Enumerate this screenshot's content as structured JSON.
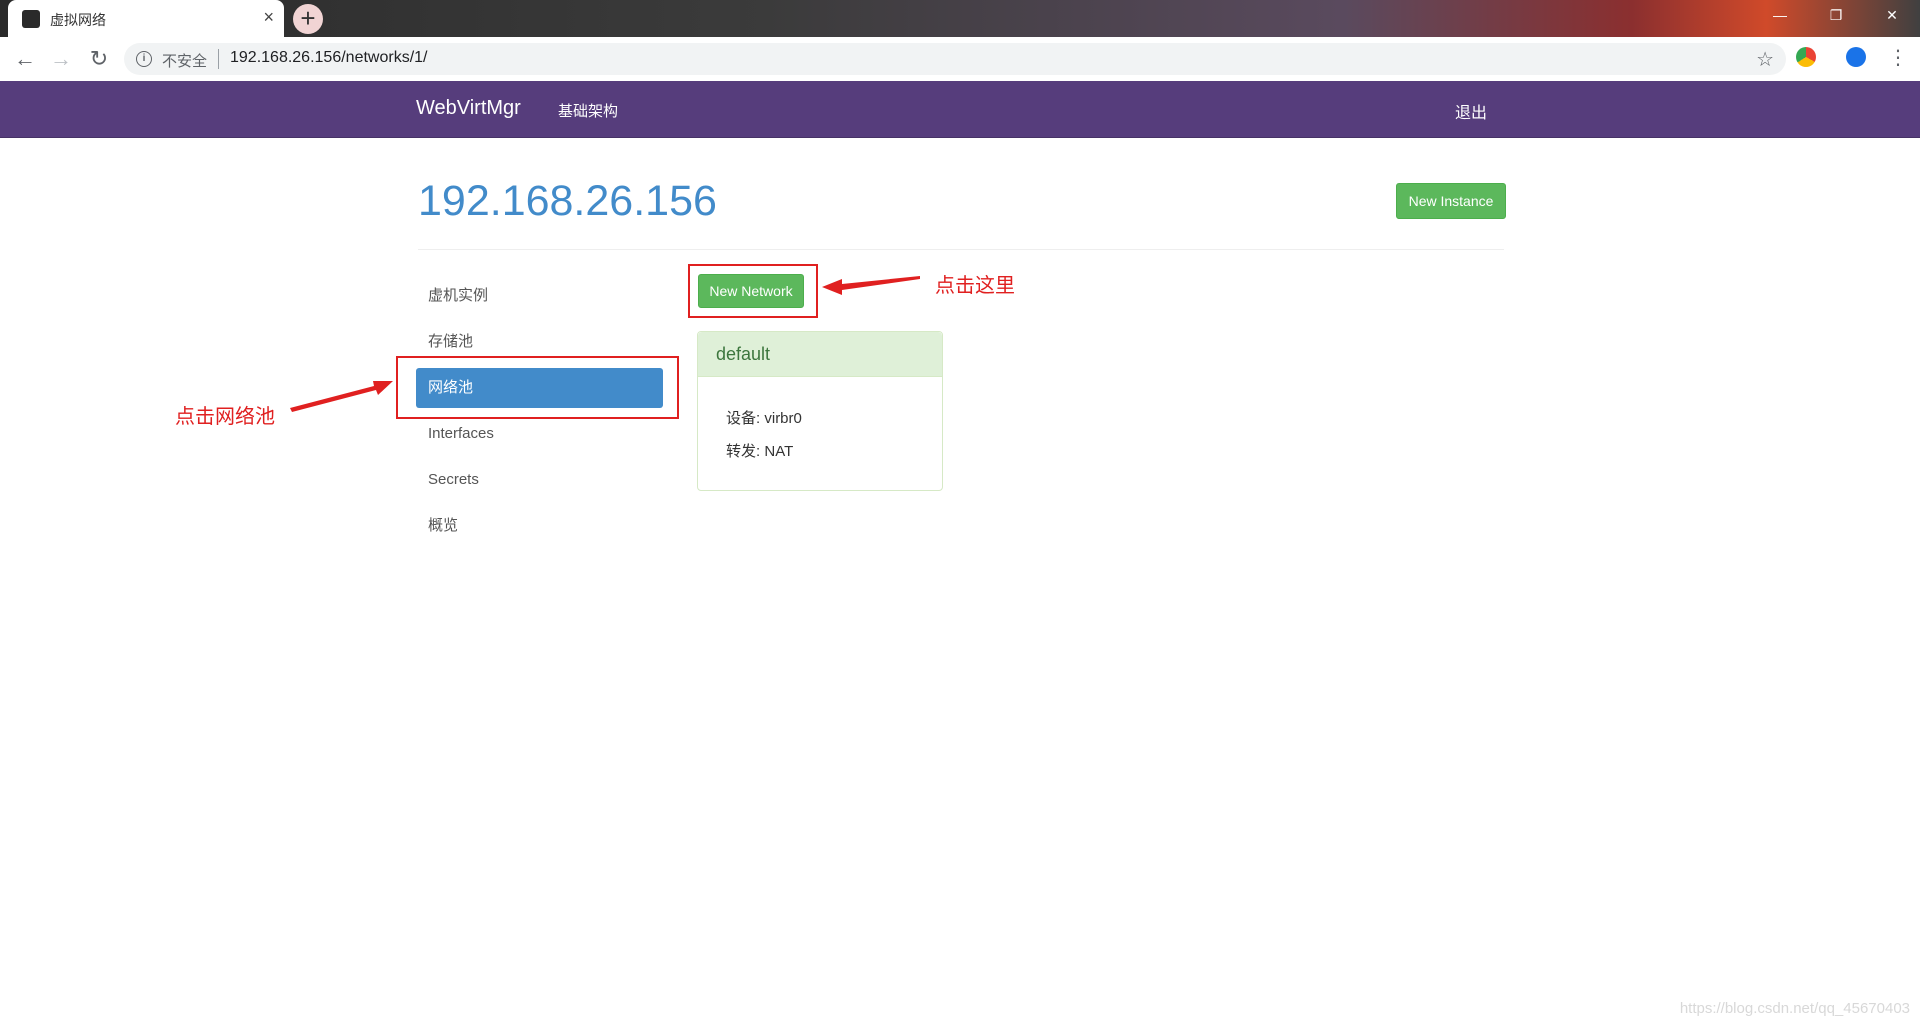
{
  "browser": {
    "tab_title": "虚拟网络",
    "tab_close": "×",
    "new_tab": "+",
    "insecure_label": "不安全",
    "url": "192.168.26.156/networks/1/",
    "window_controls": [
      "—",
      "❐",
      "✕"
    ]
  },
  "navbar": {
    "brand": "WebVirtMgr",
    "infrastructure_link": "基础架构",
    "logout": "退出"
  },
  "page": {
    "title": "192.168.26.156",
    "new_instance_label": "New Instance",
    "new_network_label": "New Network"
  },
  "sidebar": {
    "items": [
      {
        "label": "虚机实例",
        "active": false
      },
      {
        "label": "存储池",
        "active": false
      },
      {
        "label": "网络池",
        "active": true
      },
      {
        "label": "Interfaces",
        "active": false
      },
      {
        "label": "Secrets",
        "active": false
      },
      {
        "label": "概览",
        "active": false
      }
    ]
  },
  "network_panel": {
    "name": "default",
    "device_label": "设备",
    "device_value": "virbr0",
    "forward_label": "转发",
    "forward_value": "NAT"
  },
  "annotations": {
    "click_here": "点击这里",
    "click_network_pool": "点击网络池",
    "color": "#e02020"
  },
  "watermark": "https://blog.csdn.net/qq_45670403",
  "colors": {
    "navbar": "#563d7c",
    "primary": "#428bca",
    "success": "#5cb85c",
    "panel_header": "#dff0d8"
  }
}
